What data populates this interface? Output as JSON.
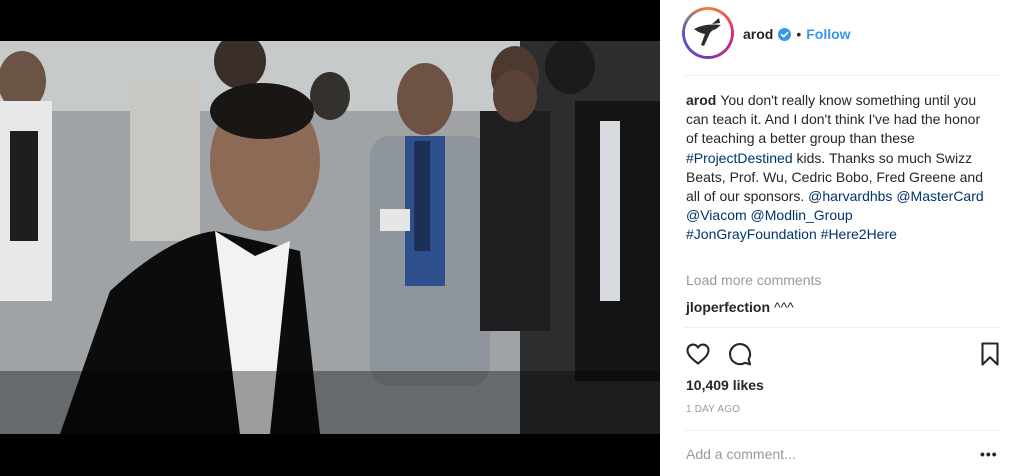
{
  "post": {
    "username": "arod",
    "follow_label": "Follow",
    "separator": "•",
    "verified_icon": "verified-badge-icon",
    "avatar_icon": "arod-logo-icon",
    "colors": {
      "accent": "#3897f0",
      "link": "#003569",
      "muted": "#999999",
      "text": "#262626",
      "divider": "#efefef"
    }
  },
  "caption": {
    "user": "arod",
    "text_1": "You don't really know something until you can teach it. And I don't think I've had the honor of teaching a better group than these ",
    "tag_project": "#ProjectDestined",
    "text_2": " kids. Thanks so much Swizz Beats, Prof. Wu, Cedric Bobo, Fred Greene and all of our sponsors. ",
    "mention_harvard": "@harvardhbs",
    "mention_mastercard": "@MasterCard",
    "mention_viacom": "@Viacom",
    "mention_modlin": "@Modlin_Group",
    "tag_jongray": "#JonGrayFoundation",
    "tag_here2here": "#Here2Here"
  },
  "comments": {
    "load_more": "Load more comments",
    "items": [
      {
        "user": "jloperfection",
        "text": "^^^"
      }
    ]
  },
  "actions": {
    "like_icon": "heart-icon",
    "comment_icon": "comment-bubble-icon",
    "save_icon": "bookmark-icon"
  },
  "stats": {
    "likes": "10,409 likes",
    "time_ago": "1 DAY AGO"
  },
  "composer": {
    "placeholder": "Add a comment...",
    "more_label": "•••"
  }
}
